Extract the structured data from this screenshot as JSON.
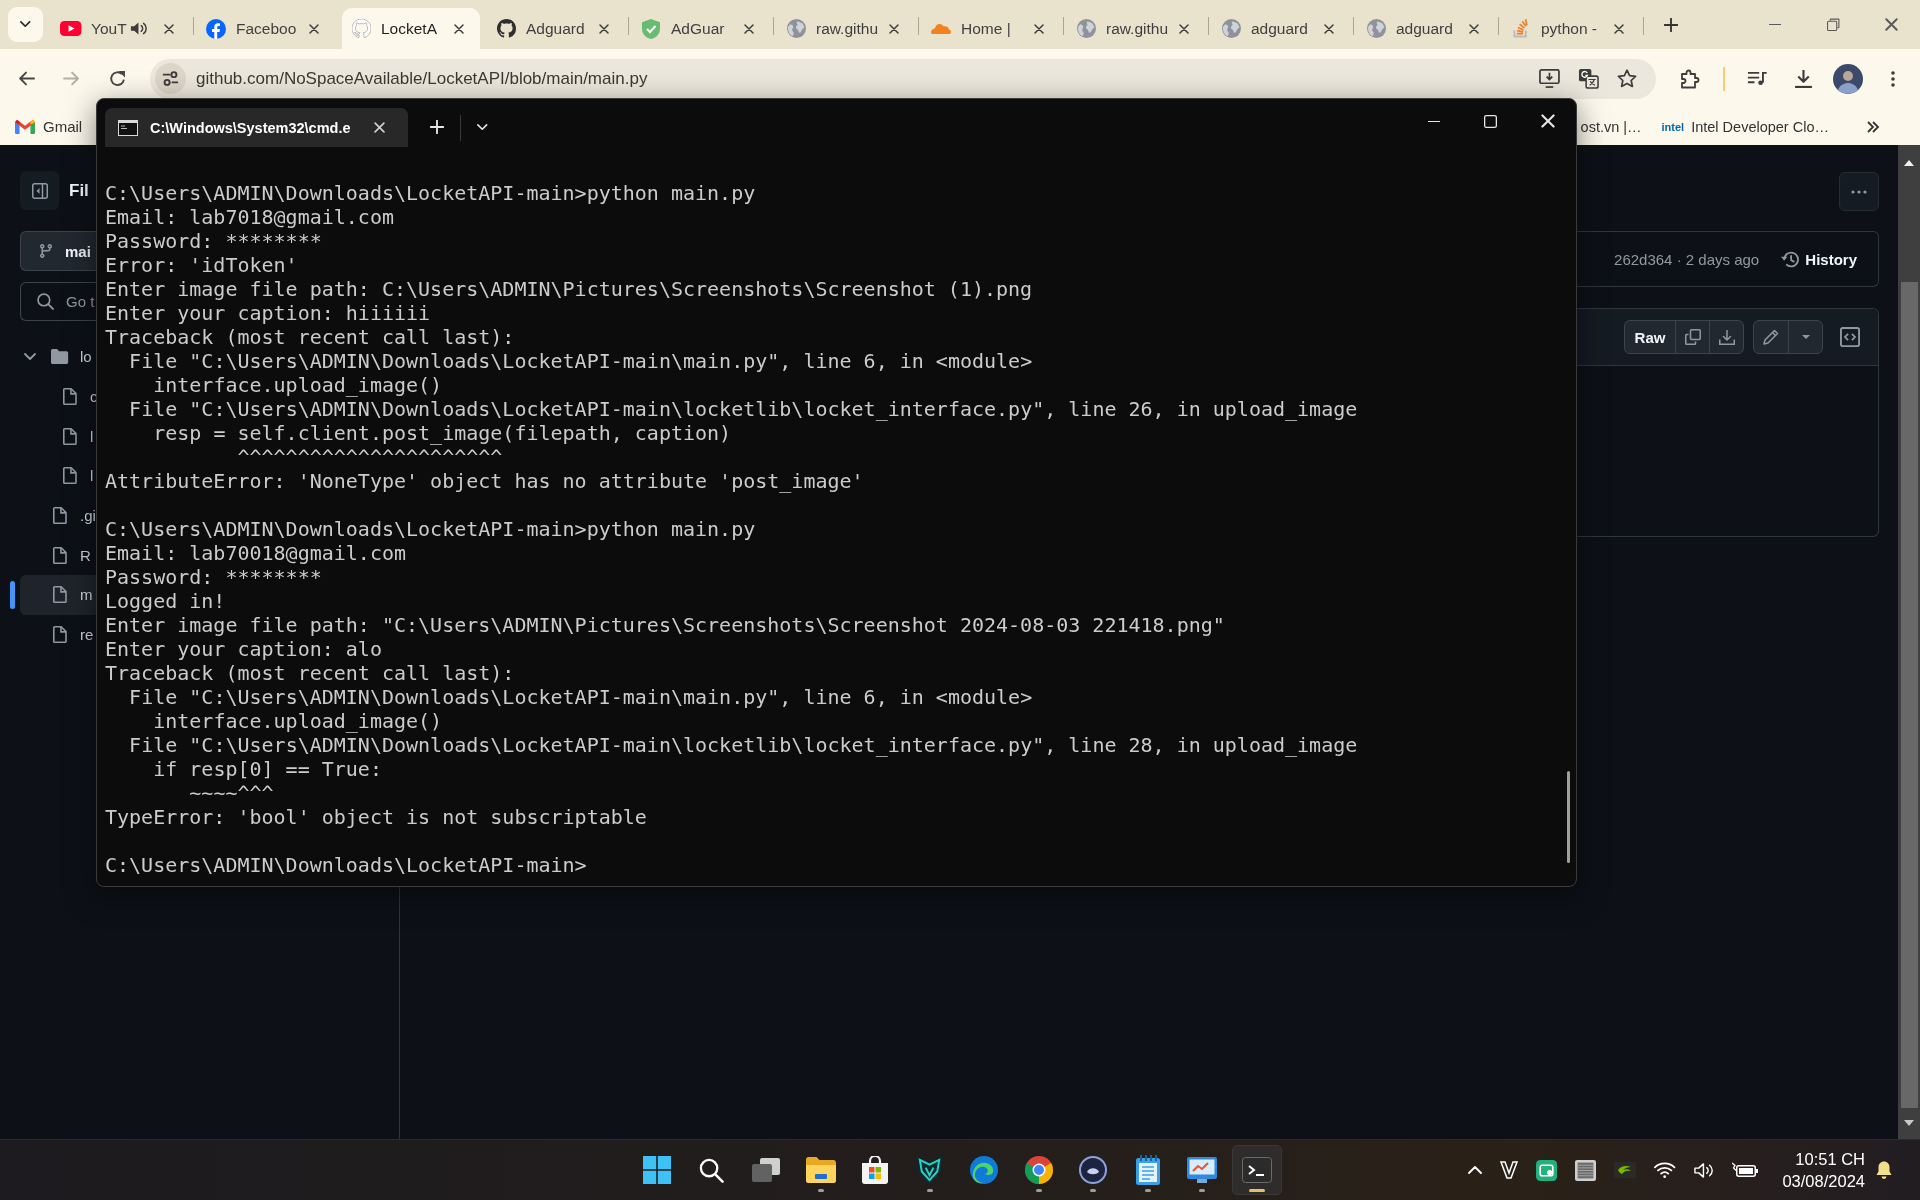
{
  "browser": {
    "tabs": [
      {
        "title": "YouT",
        "kind": "play",
        "audible": true,
        "selected": false
      },
      {
        "title": "Faceboo",
        "kind": "letter",
        "audible": false,
        "selected": false
      },
      {
        "title": "LocketA",
        "kind": "cat",
        "audible": false,
        "selected": true
      },
      {
        "title": "Adguard",
        "kind": "cat",
        "audible": false,
        "selected": false
      },
      {
        "title": "AdGuar",
        "kind": "shield",
        "audible": false,
        "selected": false
      },
      {
        "title": "raw.githu",
        "kind": "globe",
        "audible": false,
        "selected": false
      },
      {
        "title": "Home |",
        "kind": "cloud",
        "audible": false,
        "selected": false
      },
      {
        "title": "raw.githu",
        "kind": "globe",
        "audible": false,
        "selected": false
      },
      {
        "title": "adguard",
        "kind": "globe",
        "audible": false,
        "selected": false
      },
      {
        "title": "adguard",
        "kind": "globe",
        "audible": false,
        "selected": false
      },
      {
        "title": "python -",
        "kind": "stack",
        "audible": false,
        "selected": false
      }
    ],
    "nav": [
      {
        "kind": "back",
        "disabled": false
      },
      {
        "kind": "forward",
        "disabled": true
      },
      {
        "kind": "reload",
        "disabled": false
      }
    ],
    "address": {
      "url": "github.com/NoSpaceAvailable/LocketAPI/blob/main/main.py"
    },
    "bookmarks": [
      {
        "label": "Gmail",
        "kind": "mail"
      },
      {
        "label": "ost.vn |…",
        "kind": "plain"
      },
      {
        "label": "Intel Developer Clo…",
        "kind": "logo",
        "logo": "intel"
      }
    ]
  },
  "github": {
    "sidebar": {
      "title": "Fil",
      "branch": "mai",
      "search": {
        "placeholder": "Go t"
      },
      "tree": [
        {
          "name": "lo",
          "kind": "folder",
          "expanded": true,
          "selected": false,
          "children": [
            {
              "name": "c",
              "kind": "file",
              "selected": false
            },
            {
              "name": "l",
              "kind": "file",
              "selected": false
            },
            {
              "name": "l",
              "kind": "file",
              "selected": false
            }
          ]
        },
        {
          "name": ".gi",
          "kind": "file",
          "selected": false
        },
        {
          "name": "R",
          "kind": "file",
          "selected": false
        },
        {
          "name": "m",
          "kind": "file",
          "selected": true
        },
        {
          "name": "re",
          "kind": "file",
          "selected": false
        }
      ]
    },
    "commit": {
      "info": "262d364 · 2 days ago",
      "history": "History"
    },
    "file_actions": {
      "raw": "Raw"
    }
  },
  "terminal": {
    "tab_title": "C:\\Windows\\System32\\cmd.e",
    "blocks": [
      [
        "C:\\Users\\ADMIN\\Downloads\\LocketAPI-main>python main.py",
        "Email: lab7018@gmail.com",
        "Password: ********",
        "Error: 'idToken'",
        "Enter image file path: C:\\Users\\ADMIN\\Pictures\\Screenshots\\Screenshot (1).png",
        "Enter your caption: hiiiiii",
        "Traceback (most recent call last):",
        "  File \"C:\\Users\\ADMIN\\Downloads\\LocketAPI-main\\main.py\", line 6, in <module>",
        "    interface.upload_image()",
        "  File \"C:\\Users\\ADMIN\\Downloads\\LocketAPI-main\\locketlib\\locket_interface.py\", line 26, in upload_image",
        "    resp = self.client.post_image(filepath, caption)",
        "           ^^^^^^^^^^^^^^^^^^^^^^",
        "AttributeError: 'NoneType' object has no attribute 'post_image'"
      ],
      [
        "C:\\Users\\ADMIN\\Downloads\\LocketAPI-main>python main.py",
        "Email: lab70018@gmail.com",
        "Password: ********",
        "Logged in!",
        "Enter image file path: \"C:\\Users\\ADMIN\\Pictures\\Screenshots\\Screenshot 2024-08-03 221418.png\"",
        "Enter your caption: alo",
        "Traceback (most recent call last):",
        "  File \"C:\\Users\\ADMIN\\Downloads\\LocketAPI-main\\main.py\", line 6, in <module>",
        "    interface.upload_image()",
        "  File \"C:\\Users\\ADMIN\\Downloads\\LocketAPI-main\\locketlib\\locket_interface.py\", line 28, in upload_image",
        "    if resp[0] == True:",
        "       ~~~~^^^",
        "TypeError: 'bool' object is not subscriptable"
      ],
      [
        "C:\\Users\\ADMIN\\Downloads\\LocketAPI-main>"
      ]
    ]
  },
  "taskbar": {
    "apps": [
      {
        "kind": "start",
        "running": false,
        "selected": false
      },
      {
        "kind": "search",
        "running": false,
        "selected": false
      },
      {
        "kind": "taskview",
        "running": false,
        "selected": false
      },
      {
        "kind": "explorer",
        "running": true,
        "selected": false
      },
      {
        "kind": "store",
        "running": false,
        "selected": false
      },
      {
        "kind": "predator",
        "running": true,
        "selected": false
      },
      {
        "kind": "edge",
        "running": false,
        "selected": false
      },
      {
        "kind": "chrome",
        "running": true,
        "selected": false
      },
      {
        "kind": "orb",
        "running": true,
        "selected": false
      },
      {
        "kind": "notepad",
        "running": true,
        "selected": false
      },
      {
        "kind": "monitor",
        "running": true,
        "selected": false
      },
      {
        "kind": "terminal",
        "running": true,
        "selected": true
      }
    ],
    "clock": {
      "time": "10:51 CH",
      "date": "03/08/2024"
    }
  }
}
